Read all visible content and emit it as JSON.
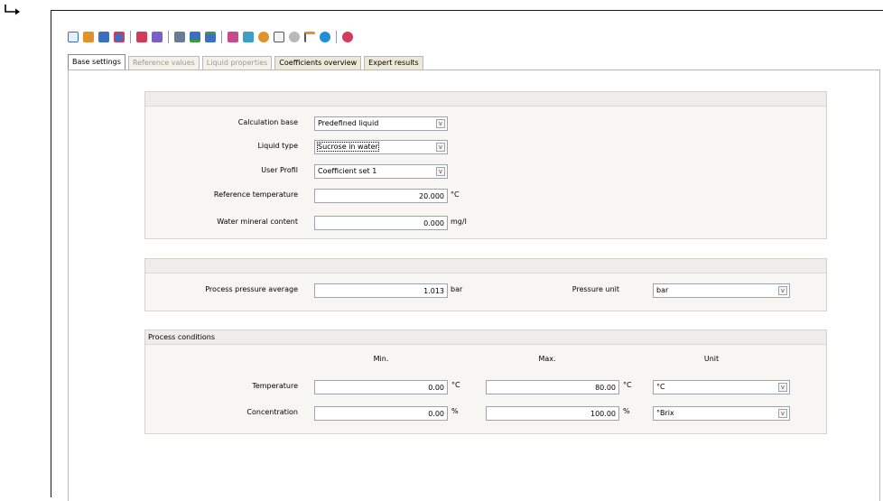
{
  "tabs": [
    {
      "label": "Base settings",
      "state": "active"
    },
    {
      "label": "Reference values",
      "state": "disabled"
    },
    {
      "label": "Liquid properties",
      "state": "disabled"
    },
    {
      "label": "Coefficients overview",
      "state": "normal"
    },
    {
      "label": "Expert results",
      "state": "normal"
    }
  ],
  "toolbar": {
    "icons": [
      "new-icon",
      "open-icon",
      "save-icon",
      "save-as-icon",
      "import-icon",
      "export-icon",
      "calculator-icon",
      "download-icon",
      "upload-icon",
      "edit-icon",
      "print-icon",
      "add-icon",
      "chart-icon",
      "user-icon",
      "flag-icon",
      "info-icon",
      "help-icon"
    ],
    "colors": {
      "blue": "#3a6fc4",
      "green": "#3c9a3c",
      "red": "#d23b5a",
      "orange": "#e0932b",
      "gray": "#b9b9b9"
    }
  },
  "panel1": {
    "calc_base": {
      "label": "Calculation base",
      "value": "Predefined liquid"
    },
    "liquid_type": {
      "label": "Liquid type",
      "value": "Sucrose in water"
    },
    "user_profile": {
      "label": "User Profil",
      "value": "Coefficient set 1"
    },
    "ref_temp": {
      "label": "Reference temperature",
      "value": "20.000",
      "unit": "°C"
    },
    "water_mineral": {
      "label": "Water mineral content",
      "value": "0.000",
      "unit": "mg/l"
    }
  },
  "panel2": {
    "pressure_avg": {
      "label": "Process pressure average",
      "value": "1.013",
      "unit": "bar"
    },
    "pressure_unit": {
      "label": "Pressure unit",
      "value": "bar"
    }
  },
  "panel3": {
    "title": "Process conditions",
    "col_min": "Min.",
    "col_max": "Max.",
    "col_unit": "Unit",
    "temperature": {
      "label": "Temperature",
      "min": "0.00",
      "min_unit": "°C",
      "max": "80.00",
      "max_unit": "°C",
      "unit": "°C"
    },
    "concentration": {
      "label": "Concentration",
      "min": "0.00",
      "min_unit": "%",
      "max": "100.00",
      "max_unit": "%",
      "unit": "°Brix"
    }
  },
  "dropdown_glyph": "v"
}
